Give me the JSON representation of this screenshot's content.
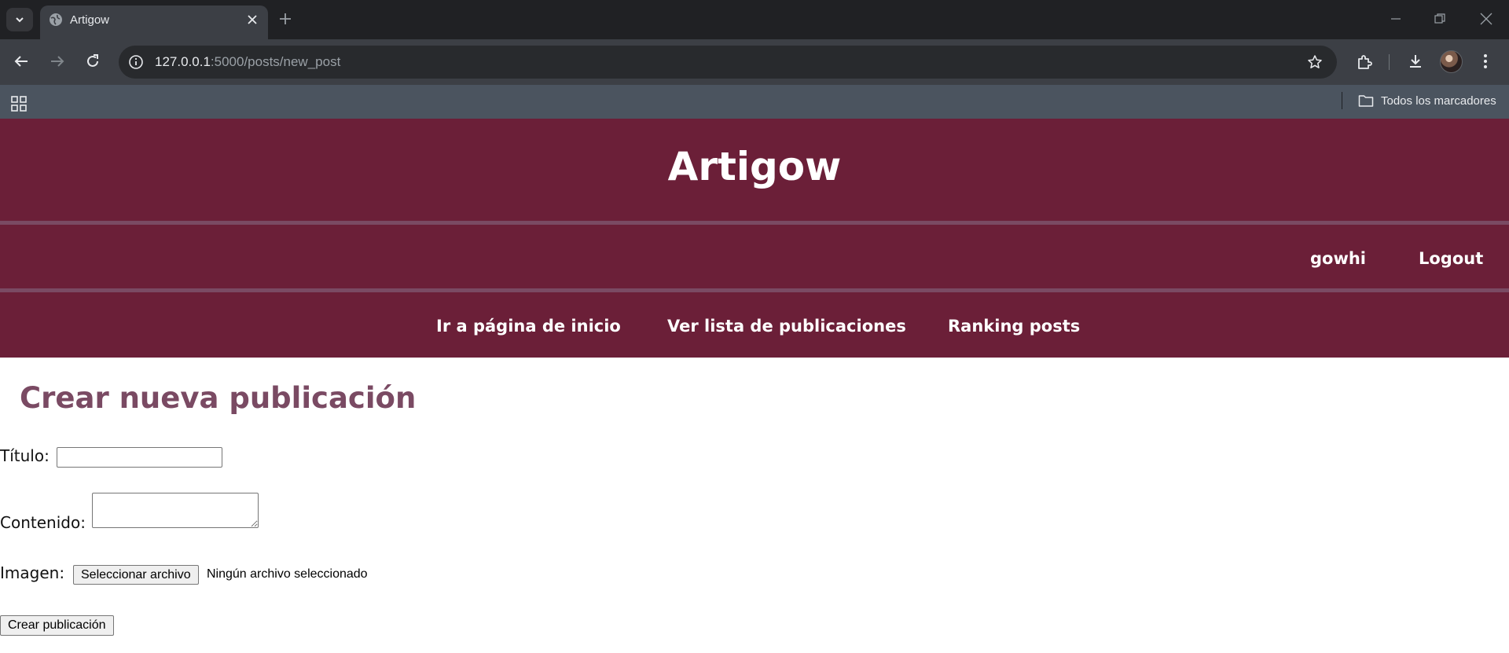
{
  "browser": {
    "tab_title": "Artigow",
    "url_host": "127.0.0.1",
    "url_rest": ":5000/posts/new_post",
    "all_bookmarks_label": "Todos los marcadores"
  },
  "site": {
    "title": "Artigow",
    "brand_color": "#6b1f38",
    "accent_color": "#7a4a63"
  },
  "user_nav": {
    "username": "gowhi",
    "logout": "Logout"
  },
  "main_nav": {
    "home": "Ir a página de inicio",
    "posts_list": "Ver lista de publicaciones",
    "ranking": "Ranking posts"
  },
  "form": {
    "heading": "Crear nueva publicación",
    "title_label": "Título:",
    "title_value": "",
    "content_label": "Contenido:",
    "content_value": "",
    "image_label": "Imagen:",
    "file_button": "Seleccionar archivo",
    "file_status": "Ningún archivo seleccionado",
    "submit": "Crear publicación"
  }
}
